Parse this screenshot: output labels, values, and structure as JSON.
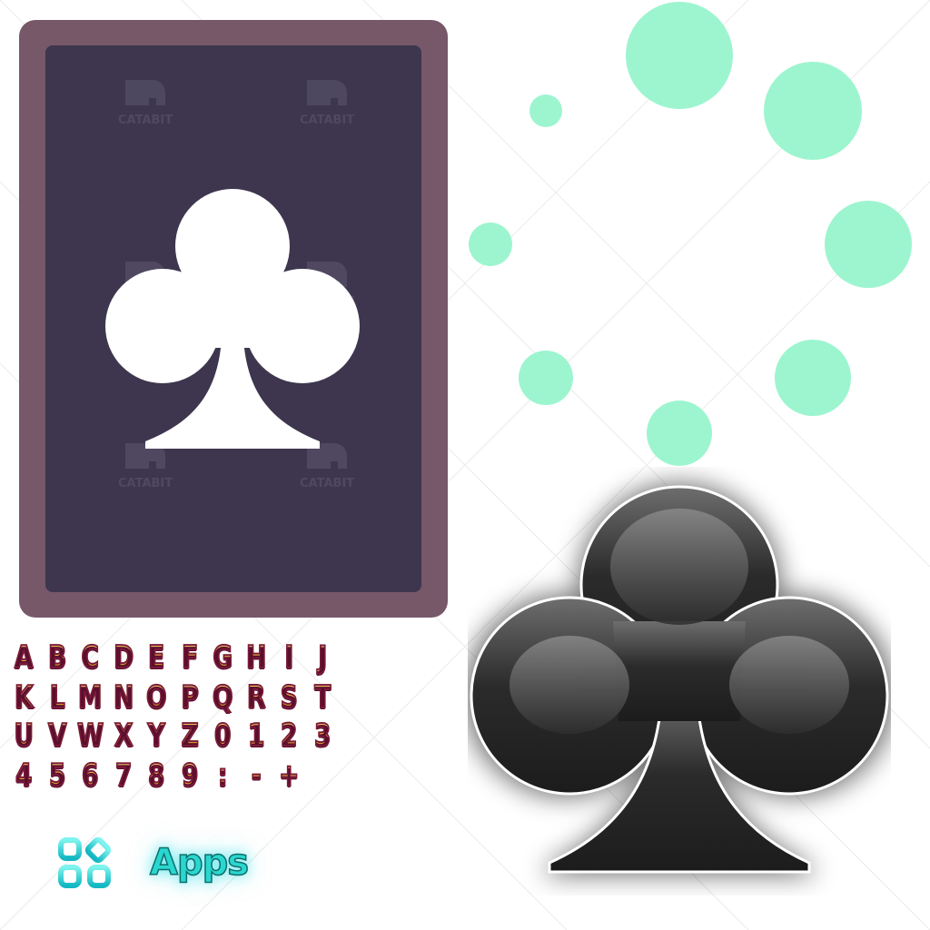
{
  "card": {
    "frame_color": "#765869",
    "face_color": "#3d364e",
    "suit_icon": "club-icon",
    "watermark_text": "CATABIT"
  },
  "loader": {
    "dot_color": "#9df5cf",
    "dot_count": 8
  },
  "glyph_sheet": {
    "rows": [
      [
        "A",
        "B",
        "C",
        "D",
        "E",
        "F",
        "G",
        "H",
        "I",
        "J"
      ],
      [
        "K",
        "L",
        "M",
        "N",
        "O",
        "P",
        "Q",
        "R",
        "S",
        "T"
      ],
      [
        "U",
        "V",
        "W",
        "X",
        "Y",
        "Z",
        "0",
        "1",
        "2",
        "3"
      ],
      [
        "4",
        "5",
        "6",
        "7",
        "8",
        "9",
        ":",
        "-",
        "+"
      ]
    ],
    "fill_color": "#e9b233",
    "outline_color": "#7a1a3d"
  },
  "apps": {
    "icon": "apps-grid-icon",
    "label": "Apps",
    "accent": "#29d7d0"
  },
  "club_button": {
    "icon": "club-icon",
    "fill_color": "#2b2b2b"
  }
}
